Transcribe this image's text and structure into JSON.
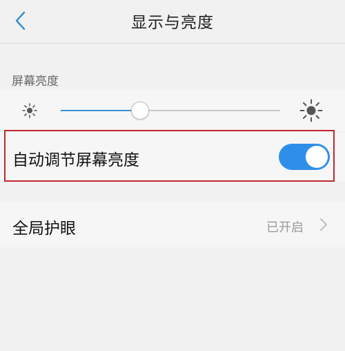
{
  "header": {
    "title": "显示与亮度",
    "back_icon": "chevron-left-icon",
    "accent_color": "#3a8fd1"
  },
  "brightness": {
    "section_label": "屏幕亮度",
    "level": 0.36,
    "min_icon": "sun-small-icon",
    "max_icon": "sun-large-icon"
  },
  "auto_brightness": {
    "label": "自动调节屏幕亮度",
    "enabled": true,
    "toggle_color": "#2f8fe8",
    "highlight_color": "#c0272d"
  },
  "eye_protection": {
    "label": "全局护眼",
    "status": "已开启",
    "chevron_icon": "chevron-right-icon"
  }
}
